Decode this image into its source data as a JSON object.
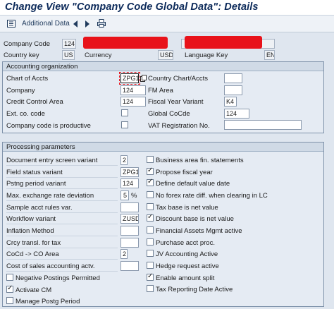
{
  "window": {
    "title": "Change View \"Company Code Global Data\": Details"
  },
  "toolbar": {
    "details_icon": "list-icon",
    "additional_data_label": "Additional Data",
    "prev_icon": "triangle-left-icon",
    "next_icon": "triangle-right-icon",
    "print_icon": "printer-icon"
  },
  "header": {
    "company_code_label": "Company Code",
    "company_code_value": "124",
    "country_key_label": "Country key",
    "country_key_value": "US",
    "currency_label": "Currency",
    "currency_value": "USD",
    "language_key_label": "Language Key",
    "language_key_value": "EN"
  },
  "accounting": {
    "title": "Accounting organization",
    "chart_of_accts_label": "Chart of Accts",
    "chart_of_accts_value": "ZPG1",
    "country_chart_label": "Country Chart/Accts",
    "company_label": "Company",
    "company_value": "124",
    "fm_area_label": "FM Area",
    "credit_control_label": "Credit Control Area",
    "credit_control_value": "124",
    "fiscal_year_variant_label": "Fiscal Year Variant",
    "fiscal_year_variant_value": "K4",
    "ext_co_code_label": "Ext. co. code",
    "global_cocde_label": "Global CoCde",
    "global_cocde_value": "124",
    "productive_label": "Company code is productive",
    "vat_label": "VAT Registration No."
  },
  "processing": {
    "title": "Processing parameters",
    "left": [
      {
        "label": "Document entry screen variant",
        "value": "2"
      },
      {
        "label": "Field status variant",
        "value": "ZPG1"
      },
      {
        "label": "Pstng period variant",
        "value": "124"
      },
      {
        "label": "Max. exchange rate deviation",
        "value": "5",
        "unit": "%"
      },
      {
        "label": "Sample acct rules var.",
        "value": ""
      },
      {
        "label": "Workflow variant",
        "value": "ZUSD"
      },
      {
        "label": "Inflation Method",
        "value": ""
      },
      {
        "label": "Crcy transl. for tax",
        "value": ""
      },
      {
        "label": "CoCd -> CO Area",
        "value": "2"
      },
      {
        "label": "Cost of sales accounting actv.",
        "value": ""
      }
    ],
    "left_checks": [
      {
        "label": "Negative Postings Permitted",
        "checked": false
      },
      {
        "label": "Activate CM",
        "checked": true
      },
      {
        "label": "Manage Postg Period",
        "checked": false
      }
    ],
    "right": [
      {
        "label": "Business area fin. statements",
        "checked": false
      },
      {
        "label": "Propose fiscal year",
        "checked": true
      },
      {
        "label": "Define default value date",
        "checked": true
      },
      {
        "label": "No forex rate diff. when clearing in LC",
        "checked": false
      },
      {
        "label": "Tax base is net value",
        "checked": false
      },
      {
        "label": "Discount base is net value",
        "checked": true
      },
      {
        "label": "Financial Assets Mgmt active",
        "checked": false
      },
      {
        "label": "Purchase acct proc.",
        "checked": false
      },
      {
        "label": "JV Accounting Active",
        "checked": false
      },
      {
        "label": "Hedge request active",
        "checked": false
      },
      {
        "label": "Enable amount split",
        "checked": true
      },
      {
        "label": "Tax Reporting Date Active",
        "checked": false
      }
    ]
  },
  "colors": {
    "title_text": "#0c2a5a",
    "redaction": "#e8121a",
    "background": "#dfe6ef",
    "group_header": "#d0dae6"
  }
}
